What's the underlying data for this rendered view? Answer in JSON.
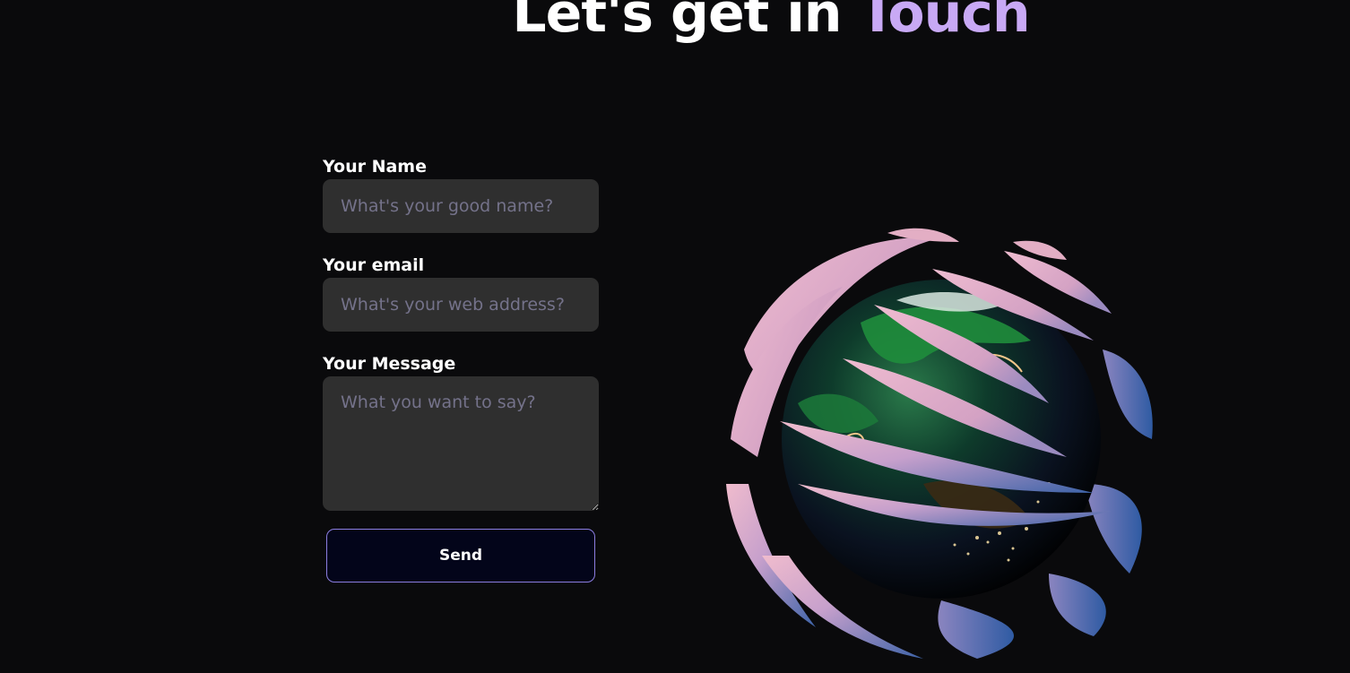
{
  "heading": {
    "lead": "Let's get in ",
    "accent": "Touch"
  },
  "form": {
    "name": {
      "label": "Your Name",
      "placeholder": "What's your good name?",
      "value": ""
    },
    "email": {
      "label": "Your email",
      "placeholder": "What's your web address?",
      "value": ""
    },
    "message": {
      "label": "Your Message",
      "placeholder": "What you want to say?",
      "value": ""
    },
    "send_label": "Send"
  },
  "colors": {
    "background": "#0a0a0c",
    "accent": "#c8a9f5",
    "field_bg": "#2f2f2f",
    "placeholder": "#74728a",
    "button_border": "#8c7ee0",
    "ribbon_pink": "#dca8bf",
    "ribbon_blue": "#3d63a8"
  },
  "illustration": {
    "icon": "earth-globe-with-swirl-ribbons-icon"
  }
}
